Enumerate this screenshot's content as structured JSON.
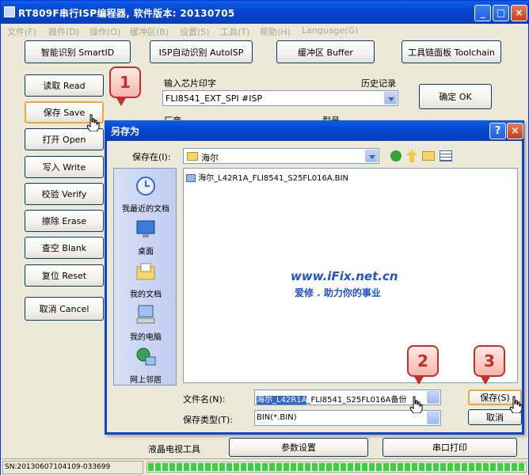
{
  "main": {
    "title": "RT809F串行ISP编程器, 软件版本: 20130705",
    "menu": [
      "文件(F)",
      "器件(D)",
      "操作(O)",
      "缓冲区(B)",
      "设置(S)",
      "工具(T)",
      "帮助(H)",
      "Language(G)"
    ],
    "top_buttons": [
      "智能识别 SmartID",
      "ISP自动识别 AutoISP",
      "缓冲区 Buffer",
      "工具链面板 Toolchain"
    ],
    "side_buttons": [
      "读取 Read",
      "保存 Save",
      "打开 Open",
      "写入 Write",
      "校验 Verify",
      "擦除 Erase",
      "查空 Blank",
      "复位 Reset",
      "取消 Cancel"
    ],
    "chip_label": "输入芯片印字",
    "history_label": "历史记录",
    "chip_value": "FLI8541_EXT_SPI #ISP",
    "confirm_button": "确定 OK",
    "vendor_label": "厂商",
    "model_label": "型号",
    "lcd_tool_label": "液晶电视工具",
    "param_button": "参数设置",
    "serial_button": "串口打印",
    "sn": "SN:20130607104109-033699",
    "progress": 1.0
  },
  "dialog": {
    "title": "另存为",
    "save_in_label": "保存在(I):",
    "save_in_value": "海尔",
    "places": [
      "我最近的文档",
      "桌面",
      "我的文档",
      "我的电脑",
      "网上邻居"
    ],
    "files": [
      "海尔_L42R1A_FLI8541_S25FL016A.BIN"
    ],
    "filename_label": "文件名(N):",
    "filename_selected": "海尔_L42R1A",
    "filename_rest": "_FLI8541_S25FL016A备份",
    "filetype_label": "保存类型(T):",
    "filetype_value": "BIN(*.BIN)",
    "save_button": "保存(S)",
    "cancel_button": "取消"
  },
  "watermark": {
    "line1": "www.iFix.net.cn",
    "line2": "爱修 . 助力你的事业"
  },
  "callouts": [
    "1",
    "2",
    "3"
  ],
  "colors": {
    "titlebar": "#0748d0",
    "accent_red": "#c0312d",
    "watermark_blue": "#2154c6",
    "progress_green": "#37d33b"
  }
}
